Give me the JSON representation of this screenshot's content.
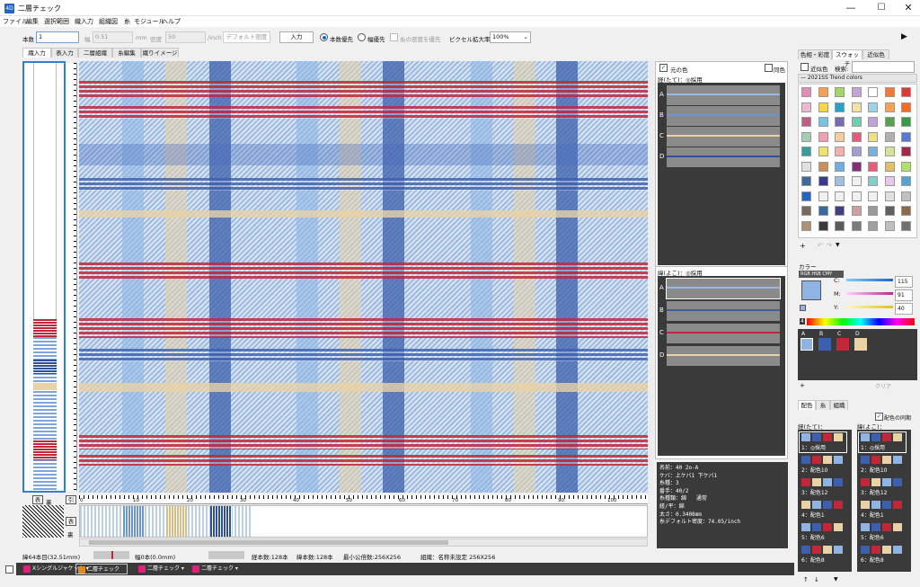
{
  "window": {
    "title": "二層チェック",
    "icon": "4D",
    "minimize": "—",
    "maximize": "☐",
    "close": "✕"
  },
  "menu": [
    "ファイル",
    "編集",
    "選択範囲",
    "織入力",
    "組織図",
    "糸",
    "モジュール",
    "ヘルプ"
  ],
  "toolbar": {
    "count_label": "本数",
    "count_value": "1",
    "width_label": "幅",
    "width_value": "0.51",
    "width_unit": "mm",
    "density_label": "密度",
    "density_value": "50",
    "density_unit": "/inch",
    "default_density_button": "デフォルト密度",
    "input_button": "入力",
    "count_priority": "本数優先",
    "width_priority": "幅優先",
    "density_priority": "糸の密度を優先",
    "zoom_label": "ピクセル拡大率",
    "zoom_value": "100%",
    "play_icon": "▶"
  },
  "tabs": [
    "織入力",
    "表入力",
    "二層組織",
    "糸編集",
    "織りイメージ"
  ],
  "bottom_left": {
    "front": "表",
    "back": "裏",
    "front2": "表",
    "back2": "裏",
    "mark": "引"
  },
  "ruler_h": [
    "0",
    "10",
    "20",
    "30",
    "40",
    "50",
    "60",
    "70",
    "80",
    "90",
    "100",
    "110",
    "120"
  ],
  "yarn_panel": {
    "original_color": "元の色",
    "same_color": "同色",
    "warp_label": "経(たて)：◎採用",
    "weft_label": "緯(よこ)：◎採用",
    "warp_rows": [
      "A",
      "B",
      "C",
      "D"
    ],
    "weft_rows": [
      "A",
      "B",
      "C",
      "D"
    ]
  },
  "yarn_info": [
    "名前：40 2o-A",
    "ケバ：上ケバ1 下ケバ1",
    "糸種：3",
    "番手：40/2",
    "糸種類：綿   通常",
    "縒/平：綿",
    "太さ：0.3408mm",
    "糸デフォルト密度：74.05/inch"
  ],
  "status": {
    "weft_pos": "緯64本目(32.51mm)",
    "width": "幅0本(0.0mm)",
    "warp_count": "経本数:128本",
    "weft_count": "緯本数:128本",
    "lcm": "最小公倍数:256X256",
    "weave": "組織：名称未設定  256X256"
  },
  "files": [
    "Xシングルジャケット ▾",
    "二層チェック",
    "二層チェック ▾",
    "二層チェック ▾"
  ],
  "right": {
    "tabs": [
      "色相・彩度",
      "スウォッチ",
      "近似色"
    ],
    "near_color": "近似色",
    "search_label": "検索:",
    "palette_name": "— 2021SS Trend colors",
    "color_header": "カラー",
    "color_modes": [
      "RGB",
      "HSB",
      "CMY"
    ],
    "cmy": {
      "c_label": "C:",
      "c_value": "115",
      "m_label": "M:",
      "m_value": "91",
      "y_label": "Y:",
      "y_value": "40"
    },
    "index": "4",
    "chips": [
      "A",
      "B",
      "C",
      "D"
    ],
    "clear": "クリア",
    "bottom_tabs": [
      "配色",
      "糸",
      "組織"
    ],
    "sync": "配色の同期",
    "warp_list_label": "経(たて)：",
    "weft_list_label": "緯(よこ)：",
    "warp_items": [
      "1：◎採用",
      "2：配色10",
      "3：配色12",
      "4：配色1",
      "5：配色6",
      "6：配色8"
    ],
    "weft_items": [
      "1：◎採用",
      "2：配色10",
      "3：配色12",
      "4：配色1",
      "5：配色6",
      "6：配色8"
    ]
  },
  "colors": {
    "blue": "#3c5fae",
    "lightblue": "#8fb3e2",
    "red": "#c0283a",
    "cream": "#e8d2a6",
    "accent": "#1e66c8"
  }
}
